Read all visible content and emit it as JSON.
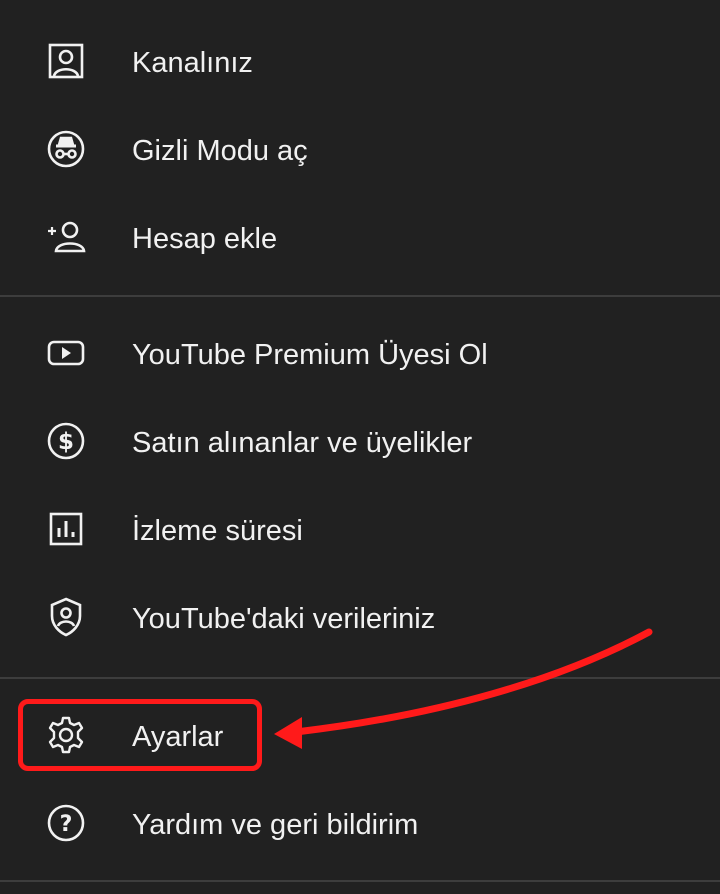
{
  "colors": {
    "background": "#212121",
    "text": "#f1f1f1",
    "icon": "#f1f1f1",
    "divider": "#3d3d3d",
    "annotation": "#ff1a1a"
  },
  "menu": {
    "account_section": [
      {
        "label": "Kanalınız",
        "icon": "account-box-icon"
      },
      {
        "label": "Gizli Modu aç",
        "icon": "incognito-icon"
      },
      {
        "label": "Hesap ekle",
        "icon": "add-account-icon"
      }
    ],
    "services_section": [
      {
        "label": "YouTube Premium Üyesi Ol",
        "icon": "youtube-play-icon"
      },
      {
        "label": "Satın alınanlar ve üyelikler",
        "icon": "dollar-circle-icon"
      },
      {
        "label": "İzleme süresi",
        "icon": "bar-chart-icon"
      },
      {
        "label": "YouTube'daki verileriniz",
        "icon": "shield-user-icon"
      }
    ],
    "settings_section": [
      {
        "label": "Ayarlar",
        "icon": "gear-icon"
      },
      {
        "label": "Yardım ve geri bildirim",
        "icon": "help-circle-icon"
      }
    ]
  },
  "annotation": {
    "highlight_target": "Ayarlar",
    "style": "red-box-with-arrow"
  }
}
